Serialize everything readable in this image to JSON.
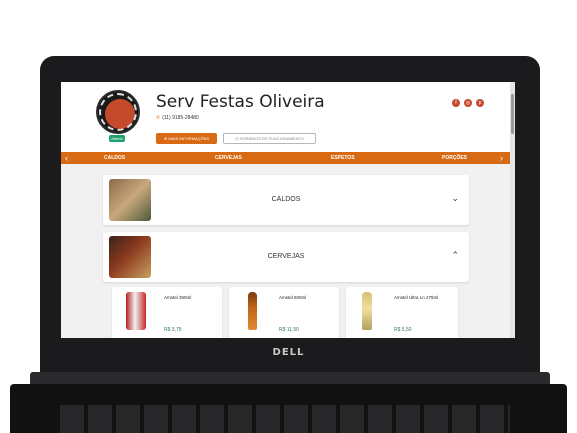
{
  "device": {
    "brand": "DELL"
  },
  "store": {
    "name": "Serv Festas Oliveira",
    "phone": "(11) 9185-28480",
    "status_badge": "Aberto",
    "logo_text": "SERV FESTA OLIVEIRA",
    "more_info_label": "MAIS INFORMAÇÕES",
    "hours_label": "HORÁRIOS DE FUNCIONAMENTO",
    "social": [
      "facebook-icon",
      "instagram-icon",
      "pinterest-icon"
    ]
  },
  "nav": {
    "categories": [
      "CALDOS",
      "CERVEJAS",
      "ESPETOS",
      "PORÇÕES"
    ]
  },
  "sections": [
    {
      "label": "CALDOS",
      "expanded": false
    },
    {
      "label": "CERVEJAS",
      "expanded": true
    }
  ],
  "products": [
    {
      "name": "Amstel 350ml",
      "price": "R$ 3,75"
    },
    {
      "name": "Amstel 600ml",
      "price": "R$ 11,50"
    },
    {
      "name": "Amstel Ultra Ln 275ml",
      "price": "R$ 5,50"
    }
  ],
  "colors": {
    "accent": "#d96a14",
    "brand": "#c44a2c",
    "price": "#2c7a4c",
    "open": "#22a06b"
  }
}
